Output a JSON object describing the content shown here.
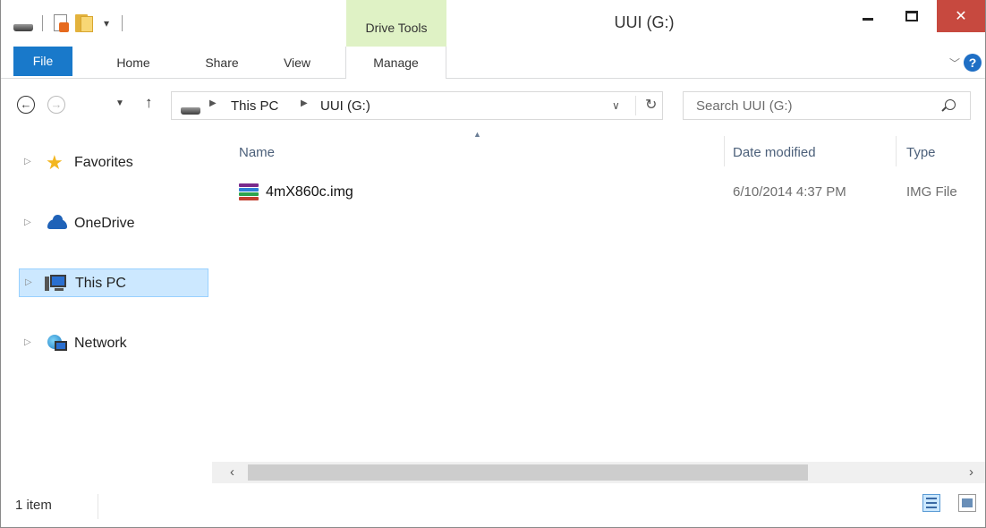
{
  "window": {
    "title": "UUI (G:)",
    "close_glyph": "✕"
  },
  "contextual_tab": {
    "label": "Drive Tools"
  },
  "ribbon": {
    "tabs": [
      {
        "label": "File"
      },
      {
        "label": "Home"
      },
      {
        "label": "Share"
      },
      {
        "label": "View"
      },
      {
        "label": "Manage"
      }
    ],
    "help_glyph": "?"
  },
  "address": {
    "crumbs": [
      "This PC",
      "UUI (G:)"
    ]
  },
  "search": {
    "placeholder": "Search UUI (G:)"
  },
  "nav_pane": {
    "items": [
      {
        "label": "Favorites",
        "icon": "star-icon"
      },
      {
        "label": "OneDrive",
        "icon": "cloud-icon"
      },
      {
        "label": "This PC",
        "icon": "computer-icon",
        "selected": true
      },
      {
        "label": "Network",
        "icon": "network-icon"
      }
    ]
  },
  "file_list": {
    "columns": [
      "Name",
      "Date modified",
      "Type"
    ],
    "rows": [
      {
        "name": "4mX860c.img",
        "date_modified": "6/10/2014 4:37 PM",
        "type": "IMG File"
      }
    ]
  },
  "status": {
    "item_count": "1 item"
  },
  "colors": {
    "file_tab": "#1979ca",
    "drive_tools": "#dff2c5",
    "close_button": "#c7493f",
    "selection": "#cce8ff"
  }
}
